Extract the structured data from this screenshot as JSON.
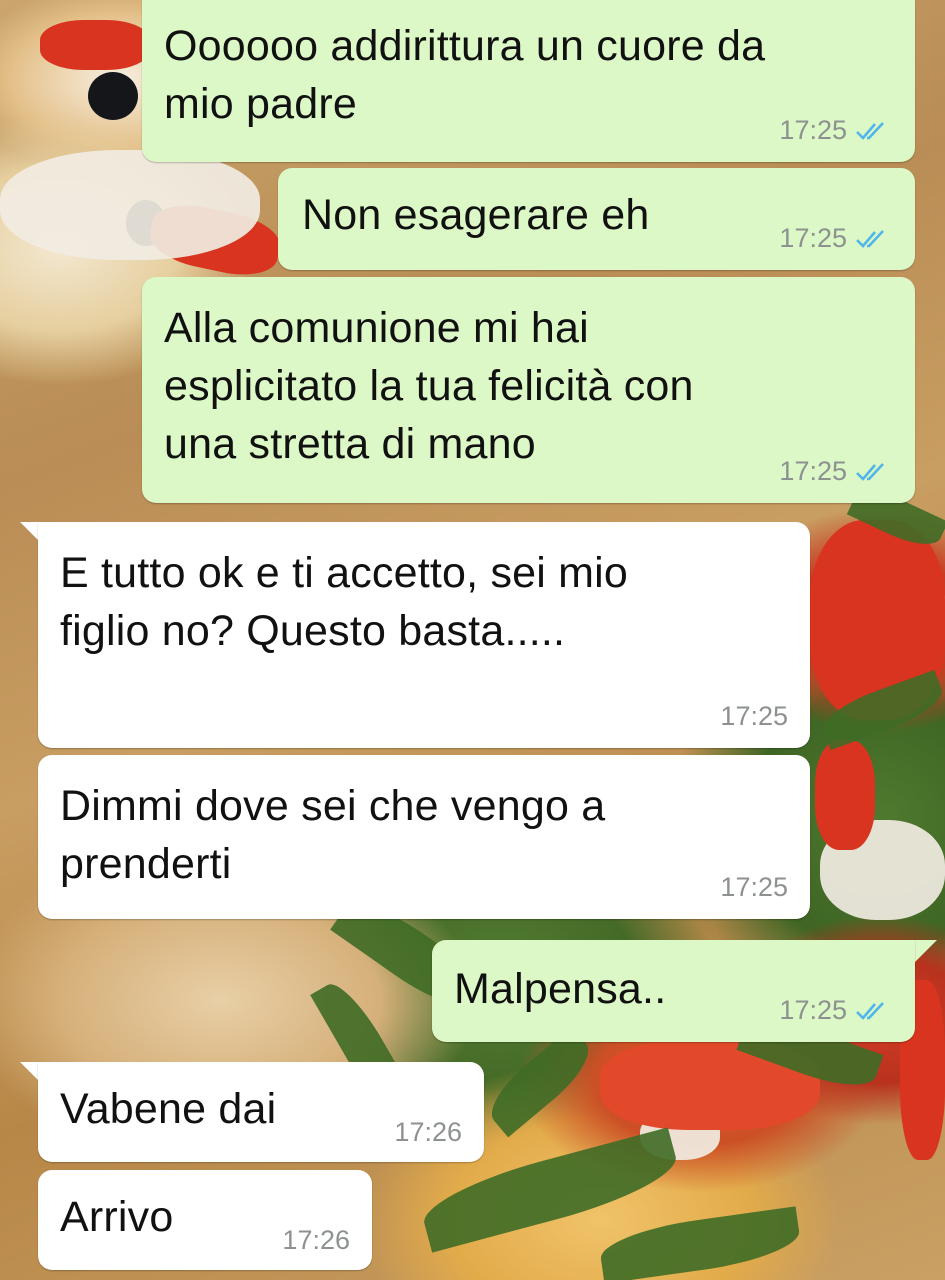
{
  "chat": {
    "messages": [
      {
        "direction": "out",
        "text": "Oooooo addirittura un cuore da\nmio padre",
        "time": "17:25",
        "status_icon": "double-check-read-icon"
      },
      {
        "direction": "out",
        "text": "Non esagerare eh",
        "time": "17:25",
        "status_icon": "double-check-read-icon"
      },
      {
        "direction": "out",
        "text": "Alla comunione mi hai\nesplicitato la tua felicità con\nuna stretta di mano",
        "time": "17:25",
        "status_icon": "double-check-read-icon"
      },
      {
        "direction": "in",
        "text": "E tutto ok e ti accetto, sei mio\nfiglio no? Questo basta.....",
        "time": "17:25"
      },
      {
        "direction": "in",
        "text": "Dimmi dove sei che vengo a\nprenderti",
        "time": "17:25"
      },
      {
        "direction": "out",
        "text": "Malpensa..",
        "time": "17:25",
        "status_icon": "double-check-read-icon"
      },
      {
        "direction": "in",
        "text": "Vabene dai",
        "time": "17:26"
      },
      {
        "direction": "in",
        "text": "Arrivo",
        "time": "17:26"
      }
    ]
  },
  "colors": {
    "outgoing_bubble": "#dcf8c6",
    "incoming_bubble": "#ffffff",
    "read_tick": "#4fb6ec",
    "timestamp": "#8d9291"
  }
}
